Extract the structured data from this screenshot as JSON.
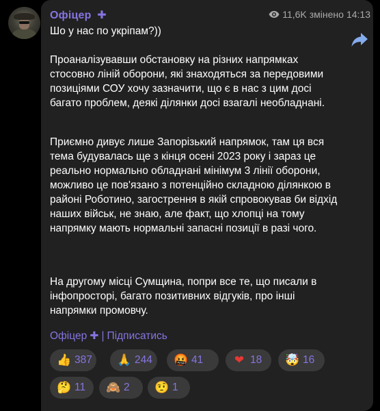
{
  "post": {
    "channel_name": "Офіцер",
    "channel_badge": "✚",
    "views": "11,6K",
    "edited_label": "змінено",
    "time": "14:13",
    "paragraphs": [
      "Шо у нас по укріпам?))",
      "Проаналізувавши обстановку на різних напрямках стосовно ліній оборони, які знаходяться за передовими позиціями СОУ хочу зазначити, що є в нас з цим досі багато проблем, деякі ділянки досі взагалі необладнані.",
      "Приємно дивує лише Запорізький напрямок, там ця вся тема будувалась ще з кінця осені 2023 року і зараз це реально нормально обладнані мінімум 3 лінії оборони, можливо це пов'язано з потенційно складною ділянкою в районі Роботино, загострення в якій спровокував би відхід наших військ, не знаю, але факт, що хлопці на тому напрямку мають нормальні запасні позиції в разі чого.",
      "На другому місці Сумщина, попри все те, що писали в інфопросторі, багато позитивних відгуків, про інші напрямки промовчу."
    ],
    "signature": {
      "name": "Офіцер",
      "badge": "✚",
      "separator": "|",
      "subscribe": "Підписатись"
    }
  },
  "reactions": [
    {
      "emoji": "👍",
      "count": "387",
      "name": "thumbs-up"
    },
    {
      "emoji": "🙏",
      "count": "244",
      "name": "folded-hands"
    },
    {
      "emoji": "🤬",
      "count": "41",
      "name": "cursing-face"
    },
    {
      "emoji": "❤",
      "count": "18",
      "name": "red-heart"
    },
    {
      "emoji": "🤯",
      "count": "16",
      "name": "exploding-head"
    },
    {
      "emoji": "🤔",
      "count": "11",
      "name": "thinking-face"
    },
    {
      "emoji": "🙈",
      "count": "2",
      "name": "see-no-evil-monkey"
    },
    {
      "emoji": "🤨",
      "count": "1",
      "name": "raised-eyebrow-face"
    }
  ],
  "colors": {
    "background": "#000000",
    "bubble": "#212121",
    "accent": "#8774e1",
    "text": "#ffffff",
    "meta": "#aaaaaa",
    "reaction_bg": "#3a3a3a"
  },
  "icons": {
    "views": "eye-icon",
    "forward": "share-arrow-icon",
    "avatar": "channel-avatar"
  }
}
